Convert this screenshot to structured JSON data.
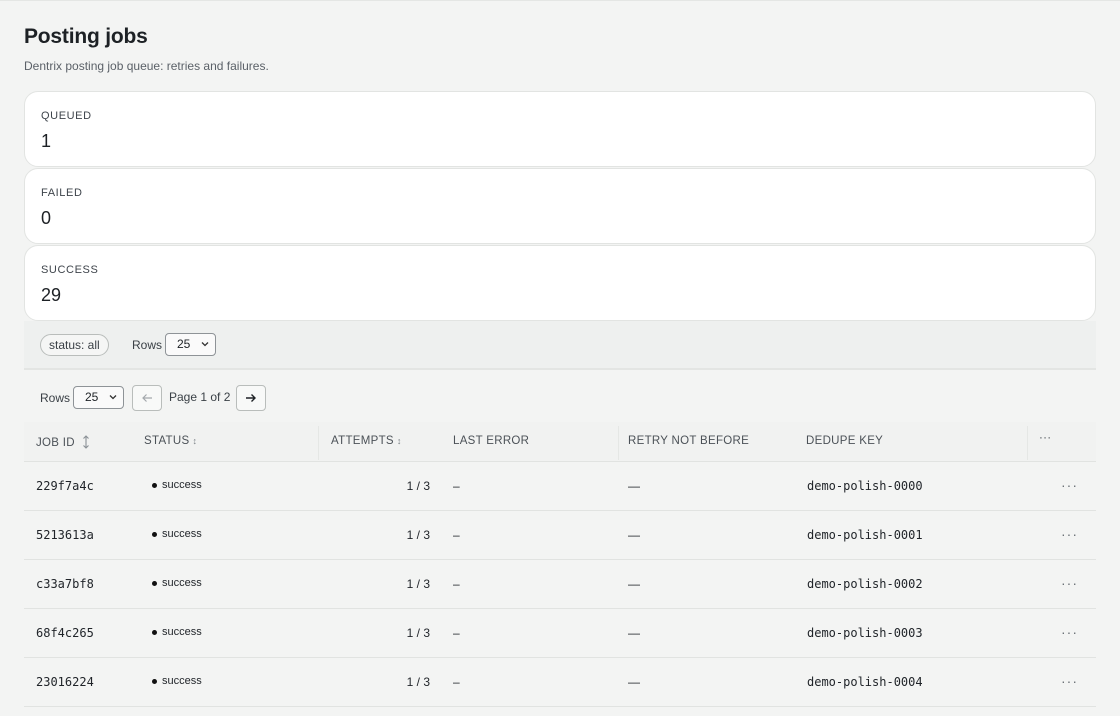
{
  "header": {
    "title": "Posting jobs",
    "subtitle": "Dentrix posting job queue: retries and failures."
  },
  "stats": [
    {
      "label": "QUEUED",
      "value": "1"
    },
    {
      "label": "FAILED",
      "value": "0"
    },
    {
      "label": "SUCCESS",
      "value": "29"
    }
  ],
  "filters": {
    "status_chip": "status: all",
    "rows_label": "Rows",
    "rows_value": "25"
  },
  "pager": {
    "rows_label": "Rows",
    "rows_value": "25",
    "prev_icon": "arrow-left-icon",
    "next_icon": "arrow-right-icon",
    "page_info": "Page 1 of 2"
  },
  "table": {
    "columns": [
      "JOB ID",
      "STATUS",
      "ATTEMPTS",
      "LAST ERROR",
      "RETRY NOT BEFORE",
      "DEDUPE KEY",
      "···"
    ],
    "rows": [
      {
        "job_id": "229f7a4c",
        "status": "success",
        "attempts": "1 / 3",
        "last_error": "–",
        "retry": "—",
        "dedupe": "demo-polish-0000",
        "more": "···"
      },
      {
        "job_id": "5213613a",
        "status": "success",
        "attempts": "1 / 3",
        "last_error": "–",
        "retry": "—",
        "dedupe": "demo-polish-0001",
        "more": "···"
      },
      {
        "job_id": "c33a7bf8",
        "status": "success",
        "attempts": "1 / 3",
        "last_error": "–",
        "retry": "—",
        "dedupe": "demo-polish-0002",
        "more": "···"
      },
      {
        "job_id": "68f4c265",
        "status": "success",
        "attempts": "1 / 3",
        "last_error": "–",
        "retry": "—",
        "dedupe": "demo-polish-0003",
        "more": "···"
      },
      {
        "job_id": "23016224",
        "status": "success",
        "attempts": "1 / 3",
        "last_error": "–",
        "retry": "—",
        "dedupe": "demo-polish-0004",
        "more": "···"
      }
    ]
  }
}
